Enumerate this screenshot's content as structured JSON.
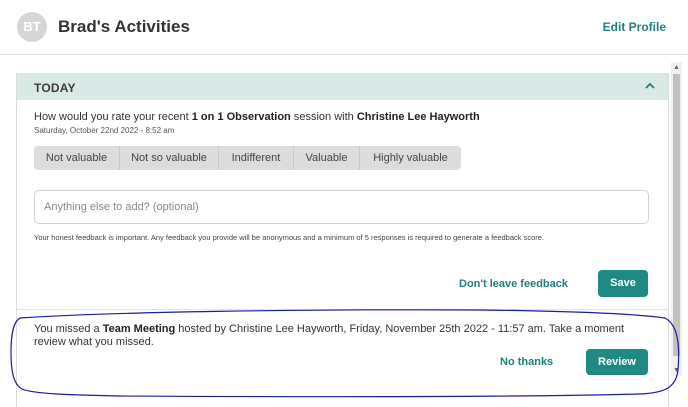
{
  "header": {
    "avatar_initials": "BT",
    "title": "Brad's Activities",
    "edit_profile": "Edit Profile"
  },
  "today": {
    "section_title": "TODAY",
    "question": {
      "prefix": "How would you rate your recent ",
      "session_type": "1 on 1 Observation",
      "middle": " session with ",
      "person": "Christine Lee Hayworth"
    },
    "date": "Saturday, October 22nd 2022 - 8:52 am",
    "ratings": [
      "Not valuable",
      "Not so valuable",
      "Indifferent",
      "Valuable",
      "Highly valuable"
    ],
    "input_placeholder": "Anything else to add? (optional)",
    "input_value": "",
    "note": "Your honest feedback is important. Any feedback you provide will be anonymous and a minimum of 5 responses is required to generate a feedback score.",
    "dont_leave_label": "Don't leave feedback",
    "save_label": "Save"
  },
  "missed": {
    "prefix": "You missed a ",
    "event": "Team Meeting",
    "rest": " hosted by Christine Lee Hayworth, Friday, November 25th 2022 - 11:57 am. Take a moment review what you missed.",
    "no_thanks_label": "No thanks",
    "review_label": "Review"
  },
  "icons": {
    "collapse": "chevron-up-icon",
    "scroll_up": "scroll-up-arrow-icon",
    "scroll_down": "scroll-down-arrow-icon"
  },
  "colors": {
    "accent": "#1f8a83",
    "link": "#1f7f7a",
    "section_bg": "#d9e9e6",
    "rating_bg": "#dcdcdc",
    "annotation": "#1a1aa6"
  }
}
